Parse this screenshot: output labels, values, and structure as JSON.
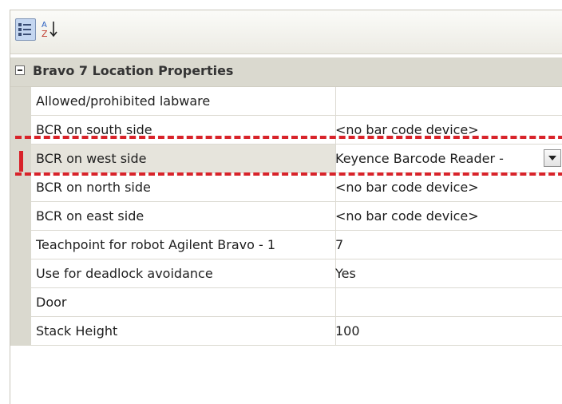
{
  "toolbar": {
    "categorized_icon": "categorized-view-icon",
    "alphabetical_icon": "alphabetical-sort-icon",
    "alphabetical_letters": [
      "A",
      "Z"
    ]
  },
  "category": {
    "title": "Bravo 7 Location Properties",
    "expanded": true
  },
  "properties": [
    {
      "name": "Allowed/prohibited labware",
      "value": ""
    },
    {
      "name": "BCR on south side",
      "value": "<no bar code device>"
    },
    {
      "name": "BCR on west side",
      "value": "Keyence Barcode Reader -",
      "has_dropdown": true,
      "selected": true
    },
    {
      "name": "BCR on north side",
      "value": "<no bar code device>"
    },
    {
      "name": "BCR on east side",
      "value": "<no bar code device>"
    },
    {
      "name": "Teachpoint for robot Agilent Bravo - 1",
      "value": "7"
    },
    {
      "name": "Use for deadlock avoidance",
      "value": "Yes"
    },
    {
      "name": "Door",
      "value": ""
    },
    {
      "name": "Stack Height",
      "value": "100"
    }
  ],
  "colors": {
    "highlight": "#d8232a",
    "category_bg": "#dad9cf"
  }
}
